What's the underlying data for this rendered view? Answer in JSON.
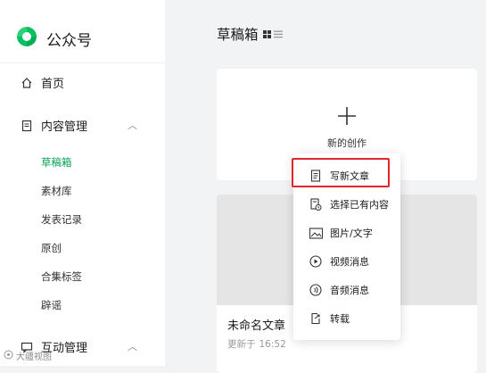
{
  "brand": {
    "name": "公众号",
    "color": "#07c160"
  },
  "sidebar": {
    "home_label": "首页",
    "content_mgmt_label": "内容管理",
    "sub_items": [
      "草稿箱",
      "素材库",
      "发表记录",
      "原创",
      "合集标签",
      "辟谣"
    ],
    "interaction_label": "互动管理"
  },
  "main": {
    "title": "草稿箱",
    "new_card_label": "新的创作",
    "article": {
      "title": "未命名文章",
      "updated_prefix": "更新于",
      "updated_time": "16:52"
    }
  },
  "dropdown": {
    "items": [
      "写新文章",
      "选择已有内容",
      "图片/文字",
      "视频消息",
      "音频消息",
      "转载"
    ],
    "highlight_color": "#e4262b"
  },
  "watermark": {
    "text": "大疆视图"
  },
  "colors": {
    "accent": "#07a35a",
    "background": "#f2f3f5"
  }
}
